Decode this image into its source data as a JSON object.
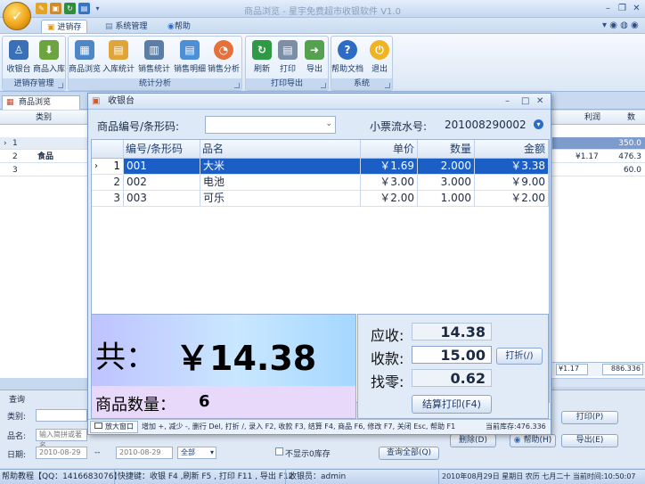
{
  "app": {
    "title": "商品浏览 - 星宇免费超市收银软件 V1.0",
    "menu_tabs": [
      "进销存",
      "系统管理",
      "帮助"
    ],
    "active_tab": 0
  },
  "ribbon": {
    "groups": [
      {
        "caption": "进销存管理",
        "buttons": [
          "收银台",
          "商品入库"
        ]
      },
      {
        "caption": "统计分析",
        "buttons": [
          "商品浏览",
          "入库统计",
          "销售统计",
          "销售明细",
          "销售分析"
        ]
      },
      {
        "caption": "打印导出",
        "buttons": [
          "刷新",
          "打印",
          "导出"
        ]
      },
      {
        "caption": "系统",
        "buttons": [
          "帮助文档",
          "退出"
        ]
      }
    ]
  },
  "doc_tab": "商品浏览",
  "grid": {
    "headers": [
      "类别",
      "利润",
      "数"
    ],
    "rows": [
      {
        "num": "1",
        "category": "",
        "profit": "",
        "qty": "350.0"
      },
      {
        "num": "2",
        "category": "食品",
        "profit": "¥1.17",
        "qty": "476.3"
      },
      {
        "num": "3",
        "category": "",
        "profit": "",
        "qty": "60.0"
      }
    ],
    "footer": {
      "profit": "¥1.17",
      "qty": "886.336"
    }
  },
  "query": {
    "title": "查询",
    "category_label": "类别:",
    "name_label": "品名:",
    "name_placeholder": "输入简拼或著名",
    "date_label": "日期:",
    "date_from": "2010-08-29",
    "date_to": "2010-08-29",
    "range_sep": "--",
    "date_mode": "全部",
    "hide_zero": "不显示0库存",
    "query_all": "查询全部(Q)",
    "print": "打印(P)",
    "delete": "删除(D)",
    "help": "帮助(H)",
    "export": "导出(E)"
  },
  "status": {
    "left": "帮助教程【QQ：1416683076】",
    "shortcuts": "快捷键：收银 F4 ,刷新 F5 , 打印 F11 , 导出 F12",
    "cashier": "收银员：admin",
    "datetime": "2010年08月29日 星期日 农历 七月二十 当前时间:10:50:07"
  },
  "cashier": {
    "title": "收银台",
    "code_label": "商品编号/条形码:",
    "code_value": "",
    "receipt_label": "小票流水号:",
    "receipt_no": "201008290002",
    "columns": [
      "编号/条形码",
      "品名",
      "单价",
      "数量",
      "金额"
    ],
    "lines": [
      {
        "num": "1",
        "code": "001",
        "name": "大米",
        "price": "￥1.69",
        "qty": "2.000",
        "amount": "￥3.38",
        "selected": true
      },
      {
        "num": "2",
        "code": "002",
        "name": "电池",
        "price": "￥3.00",
        "qty": "3.000",
        "amount": "￥9.00",
        "selected": false
      },
      {
        "num": "3",
        "code": "003",
        "name": "可乐",
        "price": "￥2.00",
        "qty": "1.000",
        "amount": "￥2.00",
        "selected": false
      }
    ],
    "total_label": "共：",
    "total_value": "￥14.38",
    "count_label": "商品数量：",
    "count_value": "6",
    "due_label": "应收:",
    "due_value": "14.38",
    "paid_label": "收款:",
    "paid_value": "15.00",
    "change_label": "找零:",
    "change_value": "0.62",
    "discount_btn": "打折(/)",
    "settle_btn": "结算打印(F4)",
    "enlarge": "放大窗口",
    "hints": "增加 +, 减少 -, 删行 Del, 打折 /, 录入 F2, 收款 F3, 结算 F4, 商品 F6, 修改 F7, 关闭 Esc, 帮助 F1",
    "stock": "当前库存:476.336"
  }
}
